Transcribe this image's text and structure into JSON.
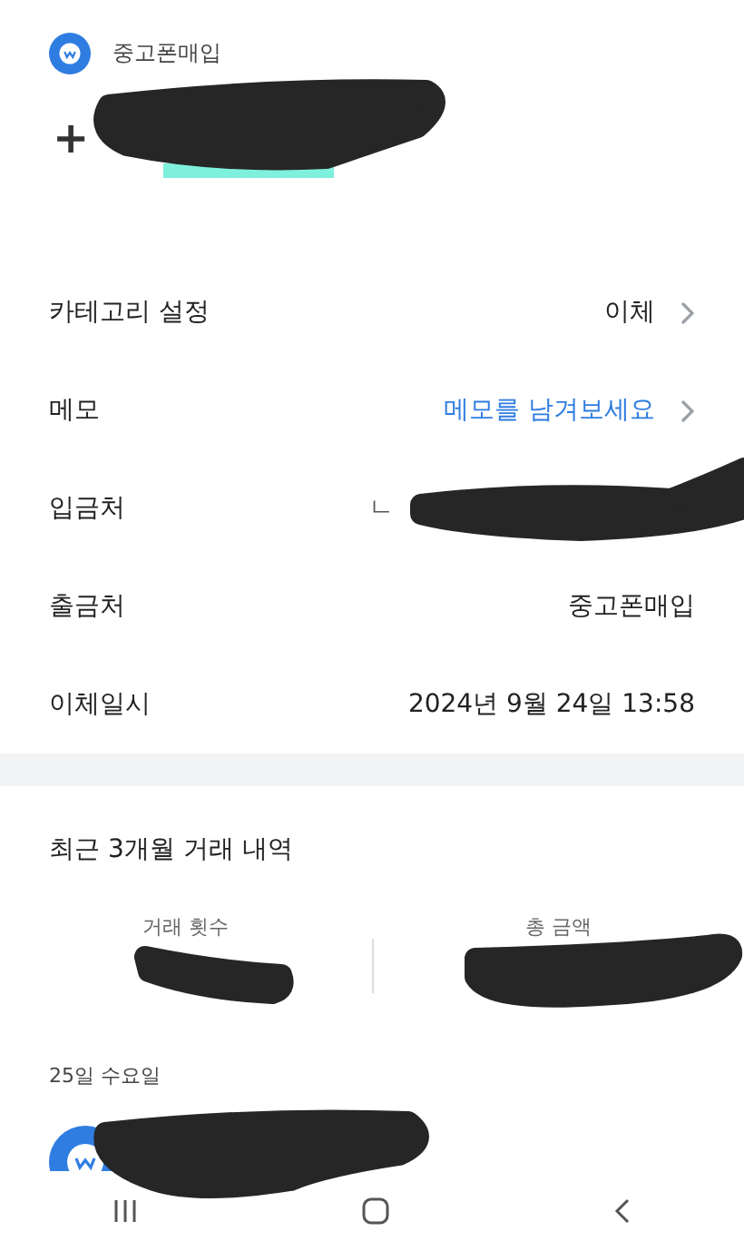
{
  "header": {
    "name": "중고폰매입"
  },
  "amount": {
    "sign": "+"
  },
  "details": [
    {
      "label": "카테고리 설정",
      "value": "이체",
      "kind": "link"
    },
    {
      "label": "메모",
      "value": "메모를 남겨보세요",
      "kind": "prompt"
    },
    {
      "label": "입금처",
      "value": "ㄴ",
      "kind": "partial"
    },
    {
      "label": "출금처",
      "value": "중고폰매입",
      "kind": "plain"
    },
    {
      "label": "이체일시",
      "value": "2024년 9월 24일 13:58",
      "kind": "plain"
    }
  ],
  "history": {
    "title": "최근 3개월 거래 내역",
    "stats": [
      {
        "label": "거래 횟수"
      },
      {
        "label": "총 금액"
      }
    ]
  },
  "transactions": [
    {
      "date": "25일 수요일"
    }
  ]
}
